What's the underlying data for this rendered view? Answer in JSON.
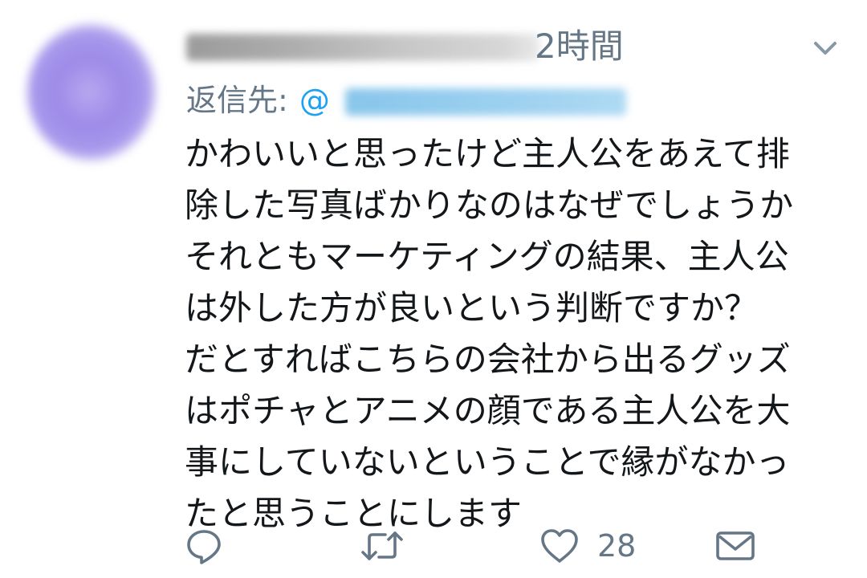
{
  "tweet": {
    "time": "2時間",
    "reply_prefix": "返信先:",
    "reply_at": "@",
    "body_lines": [
      "かわいいと思ったけど主人公をあえて排",
      "除した写真ばかりなのはなぜでしょうか",
      "それともマーケティングの結果、主人公",
      "は外した方が良いという判断ですか？",
      "だとすればこちらの会社から出るグッズ",
      "はポチャとアニメの顔である主人公を大",
      "事にしていないということで縁がなかっ",
      "たと思うことにします"
    ],
    "like_count": "28"
  },
  "colors": {
    "text": "#14171a",
    "secondary": "#657786",
    "link": "#1da1f2"
  },
  "icons": {
    "menu": "chevron-down-icon",
    "reply": "reply-icon",
    "retweet": "retweet-icon",
    "like": "heart-icon",
    "dm": "envelope-icon"
  }
}
